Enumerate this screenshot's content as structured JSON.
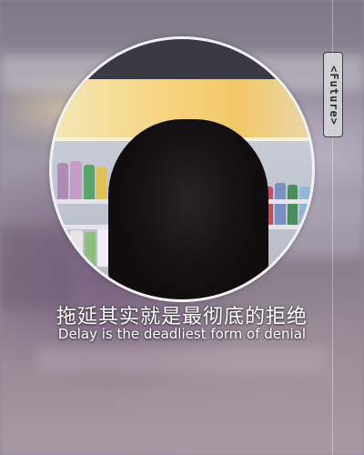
{
  "tag": {
    "text": "<Future>"
  },
  "caption": {
    "chinese": "拖延其实就是最彻底的拒绝",
    "english": "Delay is the deadliest form of denial"
  },
  "colors": {
    "caption_text": "#ffffff",
    "photo_border": "#f1f1f3",
    "tag_border": "#3a3a3a"
  }
}
